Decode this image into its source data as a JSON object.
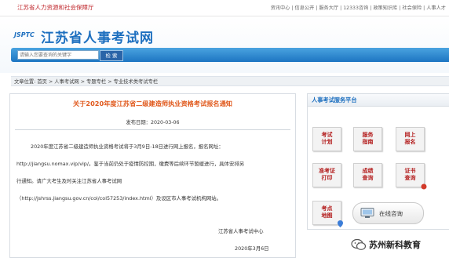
{
  "topbar": {
    "dept": "江苏省人力资源和社会保障厅",
    "links": [
      "资讯中心",
      "信息公开",
      "服务大厅",
      "12333咨询",
      "政策知识库",
      "社会保险",
      "人事人才"
    ]
  },
  "header": {
    "logo_abbr": "JSPTC",
    "site_name": "江苏省人事考试网"
  },
  "search": {
    "placeholder": "请输入您要查询的关键字",
    "button_label": "检 索"
  },
  "breadcrumb": {
    "prefix": "文章位置:",
    "items": [
      "首页",
      "人事考试网",
      "专题专栏",
      "专业技术类考试专栏"
    ],
    "separator": ">"
  },
  "article": {
    "title": "关于2020年度江苏省二级建造师执业资格考试报名通知",
    "date": "发布日期：2020-03-06",
    "para1": "2020年度江苏省二级建造师执业资格考试将于3月9日-18日进行网上报名，报名网址：",
    "para2": "http://jiangsu.nomax.vip/vip/。鉴于当前仍处于疫情防控期，缴费等后续环节暂缓进行，具体安排另",
    "para3": "行通知。请广大考生及时关注江苏省人事考试网",
    "para4": "（http://jshrss.jiangsu.gov.cn/col/col57253/index.html）及设区市人事考试机构网站。",
    "signature_org": "江苏省人事考试中心",
    "signature_date": "2020年3月6日"
  },
  "sidebar": {
    "title": "人事考试服务平台",
    "tiles": [
      {
        "line1": "考试",
        "line2": "计划"
      },
      {
        "line1": "服务",
        "line2": "指南"
      },
      {
        "line1": "网上",
        "line2": "报名"
      },
      {
        "line1": "准考证",
        "line2": "打印"
      },
      {
        "line1": "成绩",
        "line2": "查询"
      },
      {
        "line1": "证书",
        "line2": "查询"
      },
      {
        "line1": "考点",
        "line2": "地图"
      }
    ],
    "online_label": "在线咨询"
  },
  "watermark": {
    "text": "苏州新科教育",
    "icon": "wechat-icon"
  },
  "colors": {
    "brand_blue": "#1d6fbf",
    "title_orange": "#e0581b",
    "tile_red": "#b31c1c",
    "dept_red": "#c0282d"
  }
}
